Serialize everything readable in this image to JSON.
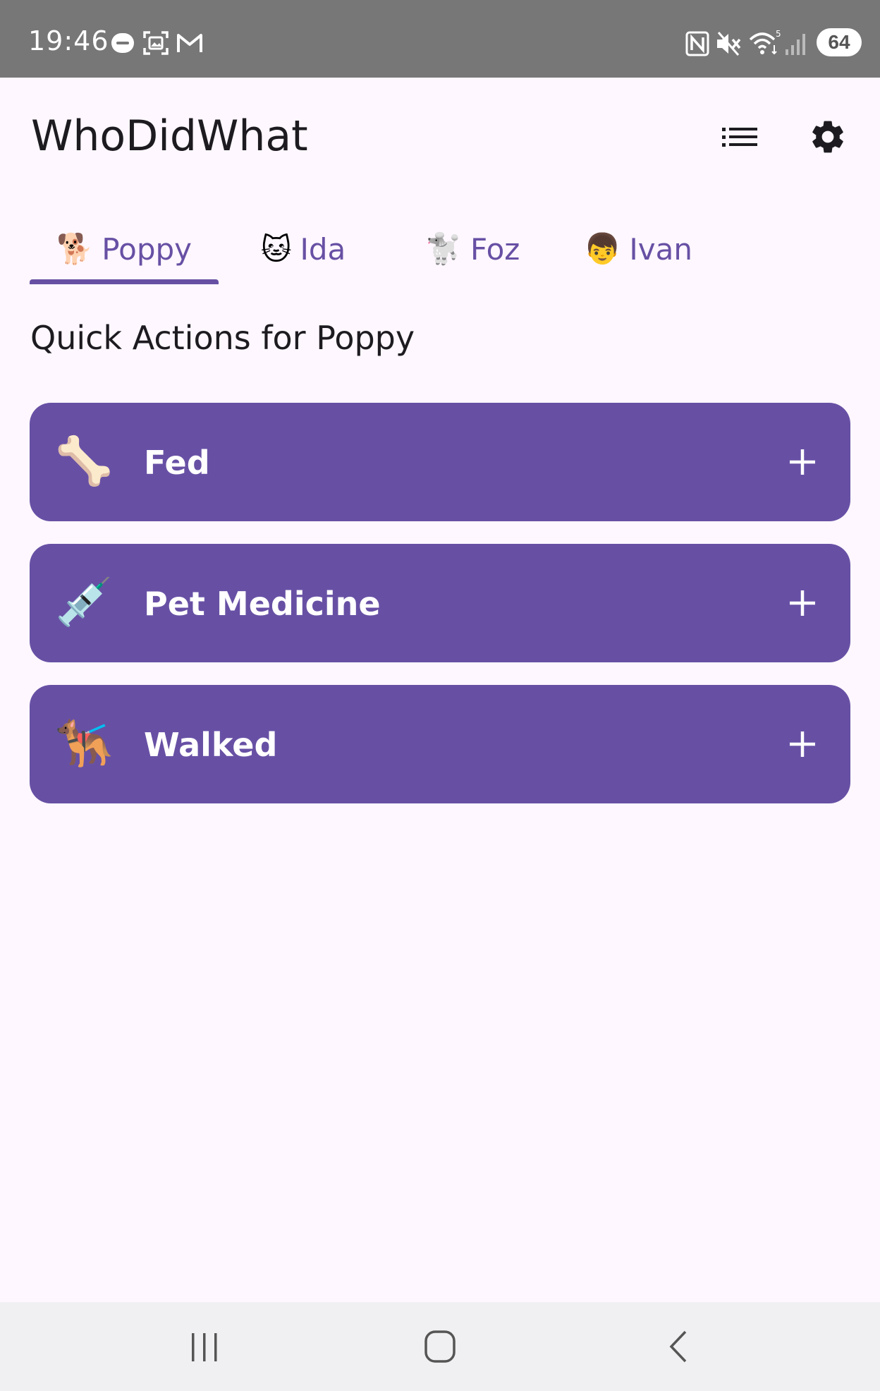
{
  "status_bar": {
    "time": "19:46",
    "battery": "64",
    "icons": [
      "wear-os-icon",
      "screenshot-icon",
      "gmail-icon",
      "nfc-icon",
      "mute-icon",
      "wifi-icon",
      "signal-icon",
      "battery-icon"
    ]
  },
  "app_bar": {
    "title": "WhoDidWhat",
    "actions": [
      "list-icon",
      "settings-icon"
    ]
  },
  "tabs": [
    {
      "emoji": "🐕",
      "label": "Poppy",
      "selected": true
    },
    {
      "emoji": "🐱",
      "label": "Ida",
      "selected": false
    },
    {
      "emoji": "🐩",
      "label": "Foz",
      "selected": false
    },
    {
      "emoji": "👦",
      "label": "Ivan",
      "selected": false
    }
  ],
  "section_title": "Quick Actions for Poppy",
  "quick_actions": [
    {
      "emoji": "🦴",
      "label": "Fed",
      "icon": "plus-icon"
    },
    {
      "emoji": "💉",
      "label": "Pet Medicine",
      "icon": "plus-icon"
    },
    {
      "emoji": "🐕‍🦺",
      "label": "Walked",
      "icon": "plus-icon"
    }
  ],
  "nav_bar": {
    "buttons": [
      "recents-icon",
      "home-icon",
      "back-icon"
    ]
  },
  "colors": {
    "primary": "#6750A4",
    "background": "#FEF7FF",
    "status_bar": "#777777",
    "nav_bar": "#F0F0F2"
  }
}
